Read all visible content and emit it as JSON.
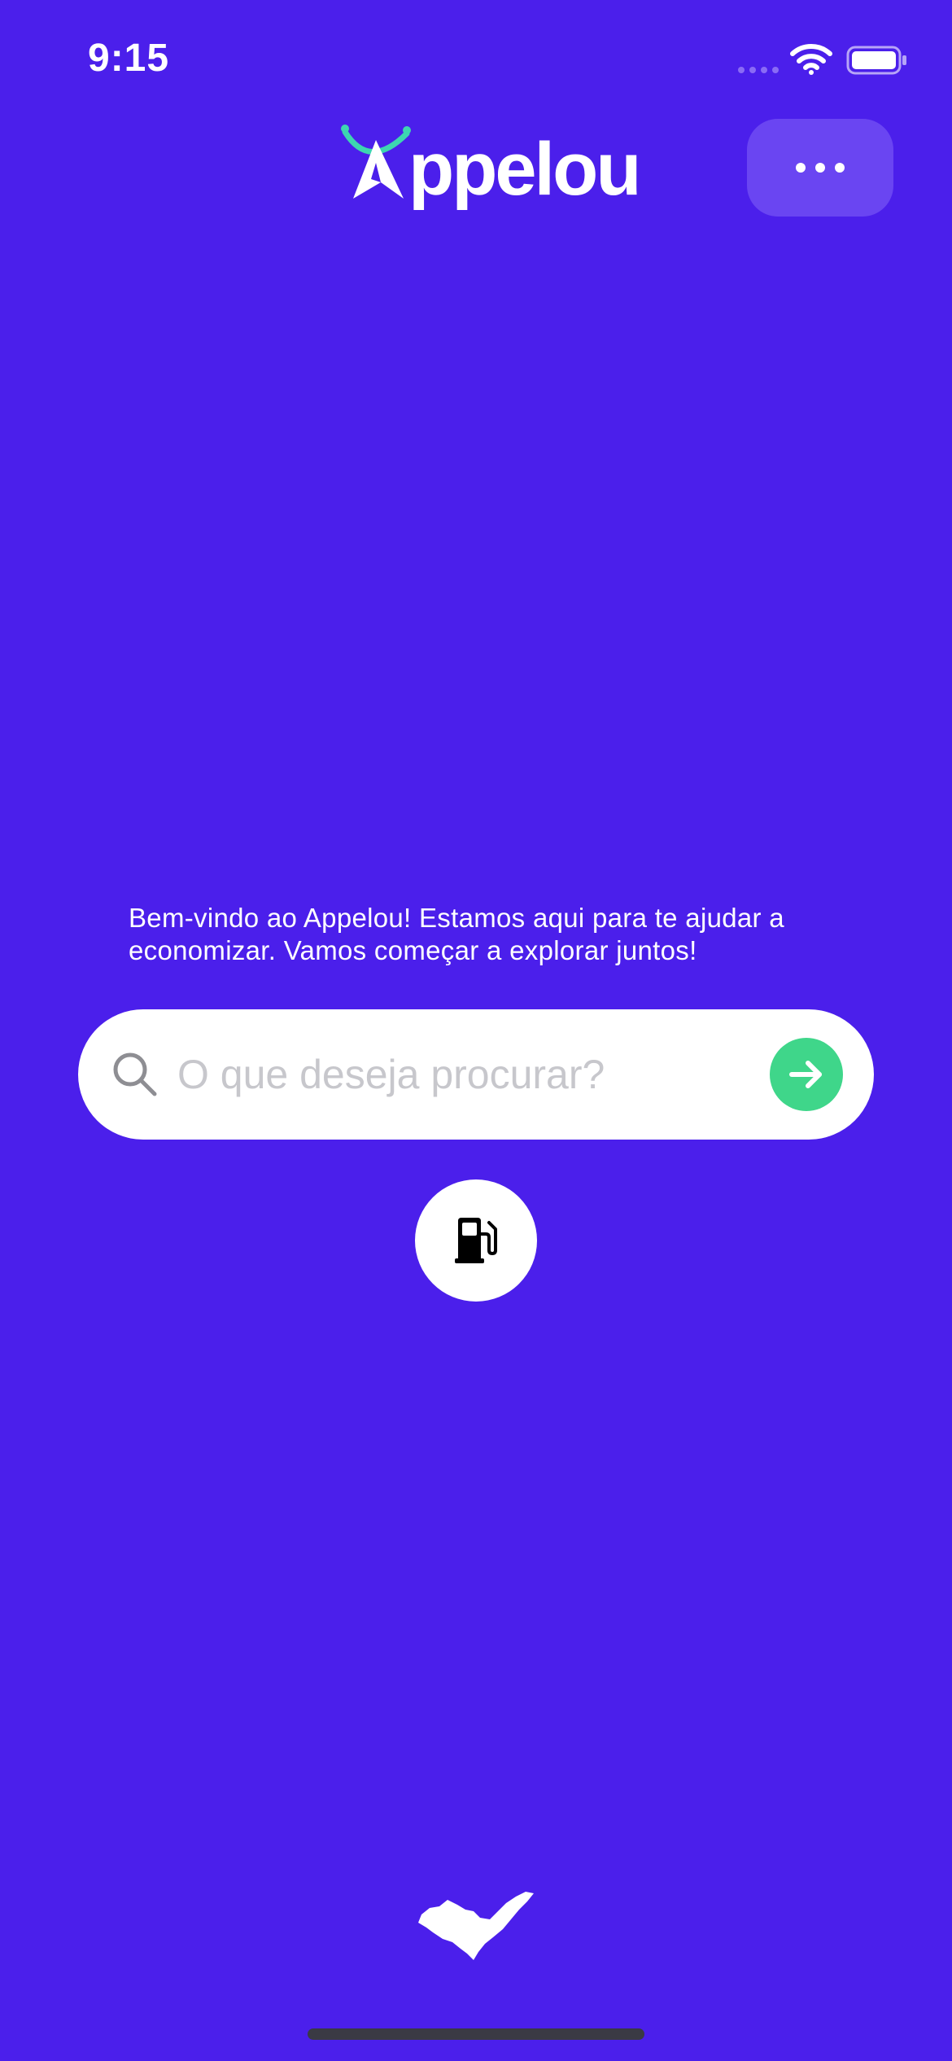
{
  "status_bar": {
    "time": "9:15",
    "icons": [
      "signal-icon",
      "wifi-icon",
      "battery-icon"
    ]
  },
  "header": {
    "logo_text": "ppelou",
    "logo_full": "Appelou",
    "menu_icon": "more-horizontal-icon"
  },
  "welcome": {
    "message": "Bem-vindo ao Appelou! Estamos aqui para te ajudar a economizar. Vamos começar a explorar juntos!"
  },
  "search": {
    "placeholder": "O que deseja procurar?",
    "value": "",
    "icon": "search-icon",
    "submit_icon": "arrow-right-icon"
  },
  "categories": [
    {
      "icon": "fuel-pump-icon"
    }
  ],
  "footer": {
    "icon": "state-map-icon"
  },
  "colors": {
    "background": "#4B1FEB",
    "menu_button": "#6A45F2",
    "accent_green": "#3FD68A",
    "logo_teal": "#3DD6B0",
    "white": "#FFFFFF"
  }
}
